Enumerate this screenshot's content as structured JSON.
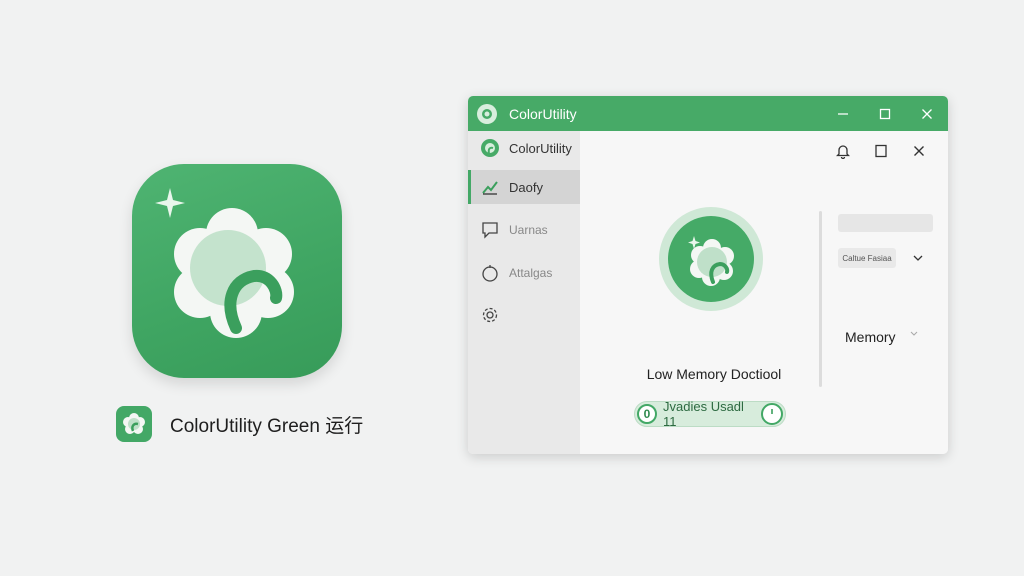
{
  "caption": {
    "text": "ColorUtility Green 运行"
  },
  "window": {
    "title": "ColorUtility",
    "titlebar_buttons": [
      "minimize",
      "maximize",
      "close"
    ],
    "sidebar": {
      "items": [
        {
          "label": "ColorUtility",
          "icon": "app-logo-icon",
          "state": "header"
        },
        {
          "label": "Daofy",
          "icon": "chart-icon",
          "state": "active"
        },
        {
          "label": "Uarnas",
          "icon": "comment-icon",
          "state": "normal"
        },
        {
          "label": "Attalgas",
          "icon": "circle-icon",
          "state": "normal"
        },
        {
          "label": "",
          "icon": "gear-icon",
          "state": "normal"
        }
      ]
    },
    "content": {
      "top_icons": [
        "bell-icon",
        "square-icon",
        "close-icon"
      ],
      "main_label": "Low Memory Doctiool",
      "pill": {
        "count": "0",
        "text": "Jvadies Usadl 11"
      },
      "right_panel": {
        "button_label": "Caltue Fasiaa",
        "memory_label": "Memory"
      }
    }
  },
  "colors": {
    "accent": "#47aa67",
    "accent_light": "#cfe8d6",
    "background": "#f1f2f2"
  }
}
